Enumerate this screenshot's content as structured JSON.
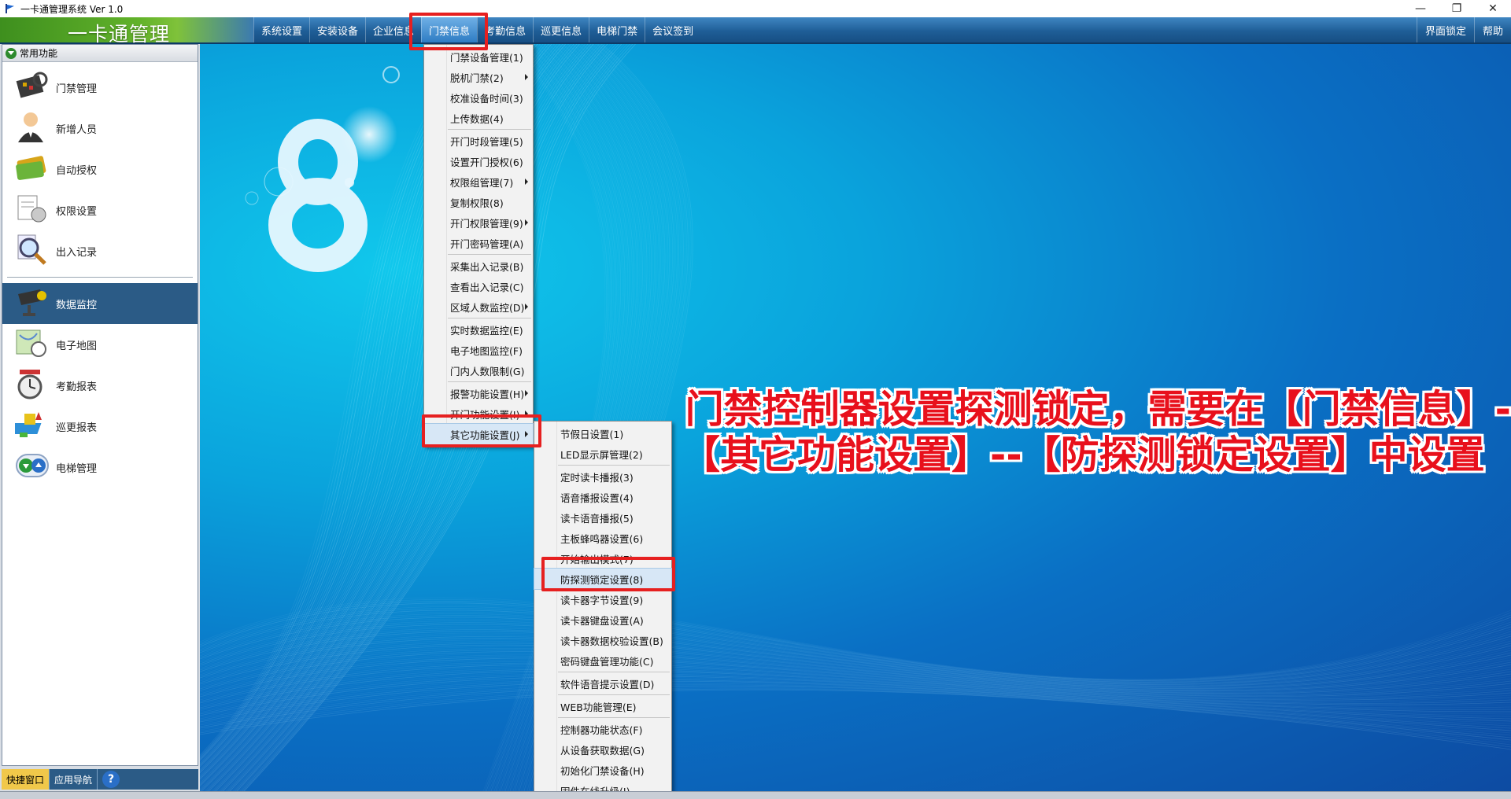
{
  "window": {
    "title": "一卡通管理系统  Ver 1.0"
  },
  "menubar": {
    "brand": "一卡通管理",
    "items": [
      "系统设置",
      "安装设备",
      "企业信息",
      "门禁信息",
      "考勤信息",
      "巡更信息",
      "电梯门禁",
      "会议签到"
    ],
    "right_items": [
      "界面锁定",
      "帮助"
    ]
  },
  "leftpanel": {
    "header": "常用功能",
    "group1": [
      {
        "label": "门禁管理",
        "icon": "circuit-board-icon"
      },
      {
        "label": "新增人员",
        "icon": "person-icon"
      },
      {
        "label": "自动授权",
        "icon": "card-icon"
      },
      {
        "label": "权限设置",
        "icon": "document-gear-icon"
      },
      {
        "label": "出入记录",
        "icon": "magnifier-icon"
      }
    ],
    "group2": [
      {
        "label": "数据监控",
        "icon": "camera-icon"
      },
      {
        "label": "电子地图",
        "icon": "map-icon"
      },
      {
        "label": "考勤报表",
        "icon": "clock-icon"
      },
      {
        "label": "巡更报表",
        "icon": "patrol-icon"
      },
      {
        "label": "电梯管理",
        "icon": "elevator-icon"
      }
    ],
    "bottom_tabs": [
      "快捷窗口",
      "应用导航"
    ]
  },
  "menu_main": [
    {
      "label": "门禁设备管理(1)"
    },
    {
      "label": "脱机门禁(2)",
      "sub": true
    },
    {
      "label": "校准设备时间(3)"
    },
    {
      "label": "上传数据(4)",
      "sep": true
    },
    {
      "label": "开门时段管理(5)"
    },
    {
      "label": "设置开门授权(6)"
    },
    {
      "label": "权限组管理(7)",
      "sub": true
    },
    {
      "label": "复制权限(8)"
    },
    {
      "label": "开门权限管理(9)",
      "sub": true
    },
    {
      "label": "开门密码管理(A)",
      "sep": true
    },
    {
      "label": "采集出入记录(B)"
    },
    {
      "label": "查看出入记录(C)"
    },
    {
      "label": "区域人数监控(D)",
      "sub": true,
      "sep": true
    },
    {
      "label": "实时数据监控(E)"
    },
    {
      "label": "电子地图监控(F)"
    },
    {
      "label": "门内人数限制(G)",
      "sep": true
    },
    {
      "label": "报警功能设置(H)",
      "sub": true
    },
    {
      "label": "开门功能设置(I)",
      "sub": true
    },
    {
      "label": "其它功能设置(J)",
      "sub": true,
      "hover": true
    }
  ],
  "menu_sub": [
    {
      "label": "节假日设置(1)"
    },
    {
      "label": "LED显示屏管理(2)",
      "sep": true
    },
    {
      "label": "定时读卡播报(3)"
    },
    {
      "label": "语音播报设置(4)"
    },
    {
      "label": "读卡语音播报(5)"
    },
    {
      "label": "主板蜂鸣器设置(6)"
    },
    {
      "label": "开始输出模式(7)"
    },
    {
      "label": "防探测锁定设置(8)",
      "hover": true
    },
    {
      "label": "读卡器字节设置(9)"
    },
    {
      "label": "读卡器键盘设置(A)"
    },
    {
      "label": "读卡器数据校验设置(B)"
    },
    {
      "label": "密码键盘管理功能(C)",
      "sep": true
    },
    {
      "label": "软件语音提示设置(D)",
      "sep": true
    },
    {
      "label": "WEB功能管理(E)",
      "sep": true
    },
    {
      "label": "控制器功能状态(F)"
    },
    {
      "label": "从设备获取数据(G)"
    },
    {
      "label": "初始化门禁设备(H)"
    },
    {
      "label": "固件在线升级(I)"
    }
  ],
  "annotation": {
    "line1": "门禁控制器设置探测锁定，需要在【门禁信息】-",
    "line2": "【其它功能设置】--【防探测锁定设置】中设置"
  },
  "colors": {
    "highlight": "#e62020",
    "annotation_text": "#e8101c",
    "menubar": "#1f5e97",
    "selected_nav": "#2b5b86"
  }
}
